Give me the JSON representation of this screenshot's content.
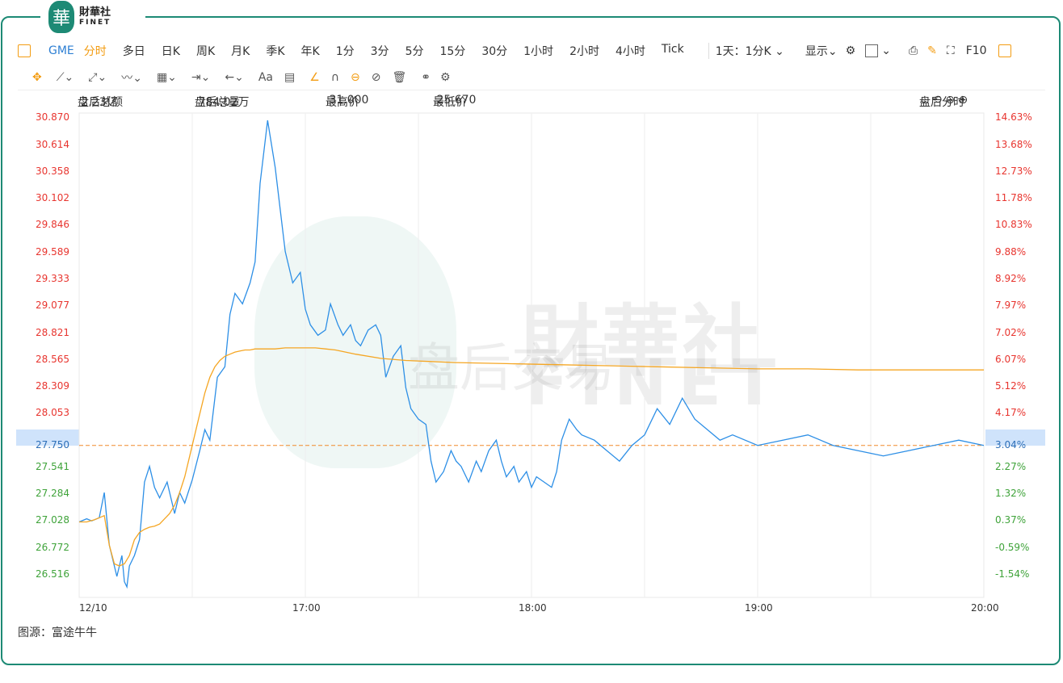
{
  "brand": {
    "cn": "財華社",
    "en": "FINET",
    "badge": "華"
  },
  "toolbar": {
    "symbol": "GME",
    "tabs": [
      "分时",
      "多日",
      "日K",
      "周K",
      "月K",
      "季K",
      "年K",
      "1分",
      "3分",
      "5分",
      "15分",
      "30分",
      "1小时",
      "2小时",
      "4小时",
      "Tick"
    ],
    "active_tab": "分时",
    "period": "1天：1分K",
    "display": "显示",
    "f10": "F10"
  },
  "drawing_tools": {
    "text_tool": "Aa"
  },
  "info": {
    "after_turnover_label": "盘后总额",
    "after_turnover": "2.23亿",
    "after_volume_label": "盘后总量",
    "after_volume": "784.02万",
    "high_label": "最高价",
    "high": "31.000",
    "low_label": "最低价",
    "low": "25.670",
    "mode": "盘后分时"
  },
  "watermark": {
    "cn": "財華社",
    "en": "FINET",
    "sub": "盘后交易"
  },
  "source": "图源：富途牛牛",
  "colors": {
    "price_line": "#2d8fe6",
    "avg_line": "#f5a623",
    "ref_line": "#f08a2c",
    "up": "#e8352f",
    "down": "#3fa33a",
    "border": "#1d8a75"
  },
  "chart_data": {
    "type": "line",
    "reference_price": 27.75,
    "y_ticks_left": [
      "30.870",
      "30.614",
      "30.358",
      "30.102",
      "29.846",
      "29.589",
      "29.333",
      "29.077",
      "28.821",
      "28.565",
      "28.309",
      "28.053",
      "27.750",
      "27.541",
      "27.284",
      "27.028",
      "26.772",
      "26.516"
    ],
    "y_ticks_right": [
      "14.63%",
      "13.68%",
      "12.73%",
      "11.78%",
      "10.83%",
      "9.88%",
      "8.92%",
      "7.97%",
      "7.02%",
      "6.07%",
      "5.12%",
      "4.17%",
      "3.04%",
      "2.27%",
      "1.32%",
      "0.37%",
      "-0.59%",
      "-1.54%"
    ],
    "x_ticks": [
      "12/10",
      "17:00",
      "18:00",
      "19:00",
      "20:00"
    ],
    "ylim": [
      26.3,
      30.92
    ],
    "series": [
      {
        "x": [
          0,
          3,
          5,
          8,
          10,
          12,
          15,
          17,
          18,
          19,
          20,
          22,
          24,
          26,
          28,
          30,
          32,
          35,
          38,
          40,
          42,
          45,
          48,
          50,
          52,
          55,
          58,
          60,
          62,
          65,
          68,
          70,
          72,
          75,
          78,
          80,
          82,
          85,
          88,
          90,
          92,
          95,
          98,
          100,
          103,
          105,
          108,
          110,
          112,
          115,
          118,
          120,
          122,
          125,
          128,
          130,
          132,
          135,
          138,
          140,
          142,
          145,
          148,
          150,
          152,
          155,
          158,
          160,
          163,
          166,
          168,
          170,
          173,
          175,
          178,
          180,
          182,
          185,
          188,
          190,
          192,
          195,
          198,
          200,
          205,
          210,
          215,
          220,
          225,
          230,
          235,
          240,
          245,
          250,
          255,
          260,
          270,
          280,
          290,
          300,
          310,
          320,
          330,
          340,
          350,
          360
        ],
        "y": [
          27.02,
          27.05,
          27.03,
          27.06,
          27.3,
          26.8,
          26.5,
          26.7,
          26.45,
          26.4,
          26.6,
          26.7,
          26.85,
          27.4,
          27.55,
          27.35,
          27.25,
          27.4,
          27.1,
          27.3,
          27.2,
          27.42,
          27.7,
          27.9,
          27.8,
          28.4,
          28.5,
          29.0,
          29.2,
          29.1,
          29.3,
          29.5,
          30.25,
          30.85,
          30.4,
          30.0,
          29.6,
          29.3,
          29.4,
          29.05,
          28.9,
          28.8,
          28.85,
          29.1,
          28.9,
          28.8,
          28.9,
          28.75,
          28.7,
          28.85,
          28.9,
          28.8,
          28.4,
          28.6,
          28.7,
          28.3,
          28.1,
          28.0,
          27.95,
          27.6,
          27.4,
          27.5,
          27.7,
          27.6,
          27.55,
          27.4,
          27.6,
          27.5,
          27.7,
          27.8,
          27.6,
          27.45,
          27.55,
          27.4,
          27.5,
          27.35,
          27.45,
          27.4,
          27.35,
          27.5,
          27.8,
          28.0,
          27.9,
          27.85,
          27.8,
          27.7,
          27.6,
          27.75,
          27.85,
          28.1,
          27.95,
          28.2,
          28.0,
          27.9,
          27.8,
          27.85,
          27.75,
          27.8,
          27.85,
          27.75,
          27.7,
          27.65,
          27.7,
          27.75,
          27.8,
          27.75
        ],
        "name": ""
      },
      {
        "x": [
          0,
          3,
          6,
          8,
          10,
          12,
          14,
          16,
          18,
          20,
          22,
          24,
          26,
          28,
          30,
          32,
          34,
          36,
          38,
          40,
          42,
          44,
          46,
          48,
          50,
          52,
          54,
          56,
          58,
          60,
          62,
          64,
          66,
          68,
          70,
          74,
          78,
          82,
          86,
          90,
          94,
          98,
          102,
          106,
          110,
          120,
          130,
          140,
          150,
          170,
          190,
          210,
          230,
          250,
          270,
          290,
          310,
          330,
          360
        ],
        "y": [
          27.02,
          27.02,
          27.04,
          27.06,
          27.08,
          26.8,
          26.62,
          26.6,
          26.62,
          26.7,
          26.85,
          26.92,
          26.95,
          26.97,
          26.98,
          27.0,
          27.05,
          27.1,
          27.18,
          27.3,
          27.45,
          27.65,
          27.85,
          28.05,
          28.25,
          28.4,
          28.5,
          28.56,
          28.6,
          28.62,
          28.64,
          28.65,
          28.66,
          28.66,
          28.67,
          28.67,
          28.67,
          28.68,
          28.68,
          28.68,
          28.68,
          28.67,
          28.66,
          28.64,
          28.62,
          28.58,
          28.56,
          28.55,
          28.54,
          28.53,
          28.52,
          28.51,
          28.5,
          28.49,
          28.48,
          28.48,
          28.47,
          28.47,
          28.47
        ],
        "name": ""
      }
    ]
  }
}
